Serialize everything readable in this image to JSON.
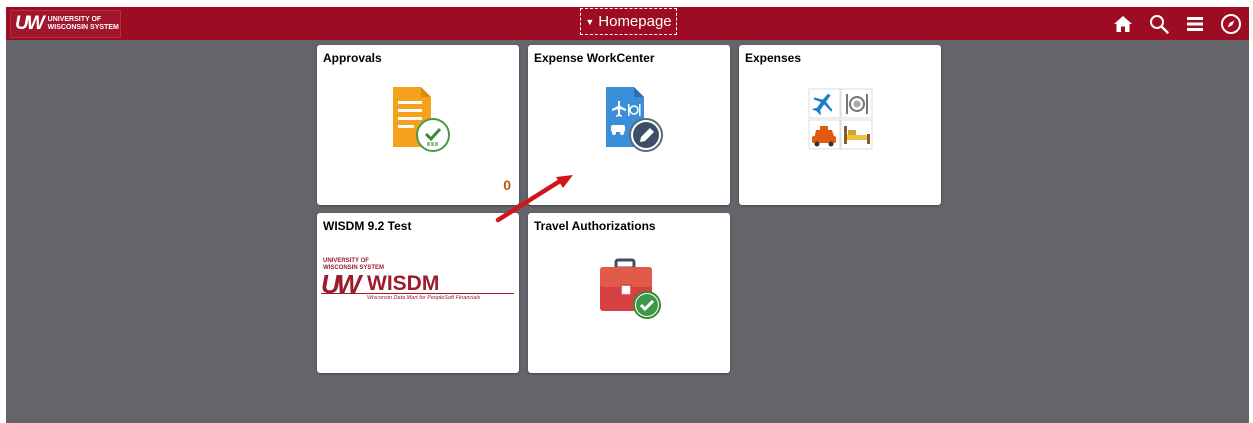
{
  "header": {
    "logo": {
      "mark": "UW",
      "line1": "University of",
      "line2": "Wisconsin System"
    },
    "title": "Homepage",
    "icons": [
      "home-icon",
      "search-icon",
      "menu-icon",
      "navigator-icon"
    ]
  },
  "tiles": [
    {
      "title": "Approvals",
      "badge": "0",
      "icon": "approvals-document-check-icon"
    },
    {
      "title": "Expense WorkCenter",
      "icon": "expense-workcenter-icon"
    },
    {
      "title": "Expenses",
      "icon": "expenses-grid-icon"
    },
    {
      "title": "WISDM 9.2 Test",
      "icon": "wisdm-logo",
      "logo": {
        "line1": "UNIVERSITY OF",
        "line2": "WISCONSIN SYSTEM",
        "mark": "UW",
        "word": "WISDM",
        "tagline": "Wisconsin Data Mart for PeopleSoft Financials"
      }
    },
    {
      "title": "Travel Authorizations",
      "icon": "travel-authorization-briefcase-icon"
    }
  ],
  "colors": {
    "header": "#9d0c22",
    "background": "#63656a",
    "arrow": "#d0161c"
  }
}
